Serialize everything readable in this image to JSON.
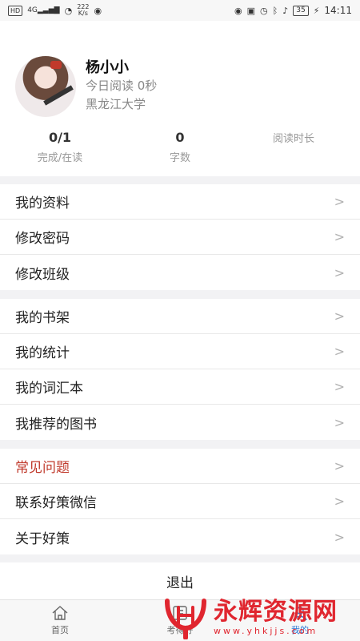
{
  "status_bar": {
    "left_badge": "HD",
    "signal": "4G",
    "net_speed_value": "222",
    "net_speed_unit": "K/s",
    "battery": "35",
    "time": "14:11"
  },
  "profile": {
    "name": "杨小小",
    "read_today": "今日阅读 0秒",
    "university": "黑龙江大学"
  },
  "stats": [
    {
      "value": "0/1",
      "label": "完成/在读"
    },
    {
      "value": "0",
      "label": "字数"
    },
    {
      "value": "",
      "label": "阅读时长"
    }
  ],
  "menu_groups": [
    [
      {
        "label": "我的资料"
      },
      {
        "label": "修改密码"
      },
      {
        "label": "修改班级"
      }
    ],
    [
      {
        "label": "我的书架"
      },
      {
        "label": "我的统计"
      },
      {
        "label": "我的词汇本"
      },
      {
        "label": "我推荐的图书"
      }
    ],
    [
      {
        "label": "常见问题",
        "highlight_color": "#c0392b"
      },
      {
        "label": "联系好策微信"
      },
      {
        "label": "关于好策"
      }
    ]
  ],
  "chevron_glyph": ">",
  "logout_label": "退出",
  "tabbar": {
    "tabs": [
      {
        "label": "首页",
        "icon": "home-icon"
      },
      {
        "label": "考得好",
        "icon": "book-icon"
      },
      {
        "label": "我的",
        "icon": "user-icon",
        "active": true
      }
    ]
  },
  "watermark": {
    "title": "永辉资源网",
    "url": "www.yhkjjs.com",
    "color": "#e0262f"
  }
}
